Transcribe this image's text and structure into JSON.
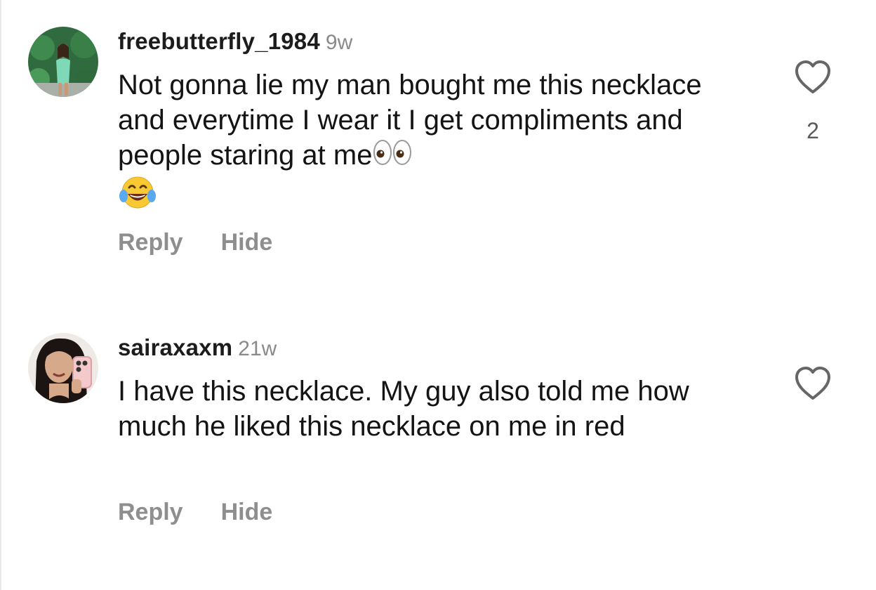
{
  "colors": {
    "username": "#1c1c1c",
    "meta": "#8a8a8a",
    "action": "#8e8e8e",
    "heart_stroke": "#666666"
  },
  "comments": [
    {
      "username": "freebutterfly_1984",
      "time": "9w",
      "text": "Not gonna lie my man bought me this necklace and everytime I wear it I get compliments and people staring at me",
      "emojis": [
        "eyes",
        "face-with-tears-of-joy"
      ],
      "likes": "2",
      "reply_label": "Reply",
      "hide_label": "Hide",
      "icon": "heart-outline-icon"
    },
    {
      "username": "sairaxaxm",
      "time": "21w",
      "text": "I have this necklace. My guy also told me how much he liked this necklace on me in red",
      "likes": "",
      "reply_label": "Reply",
      "hide_label": "Hide",
      "icon": "heart-outline-icon"
    }
  ]
}
